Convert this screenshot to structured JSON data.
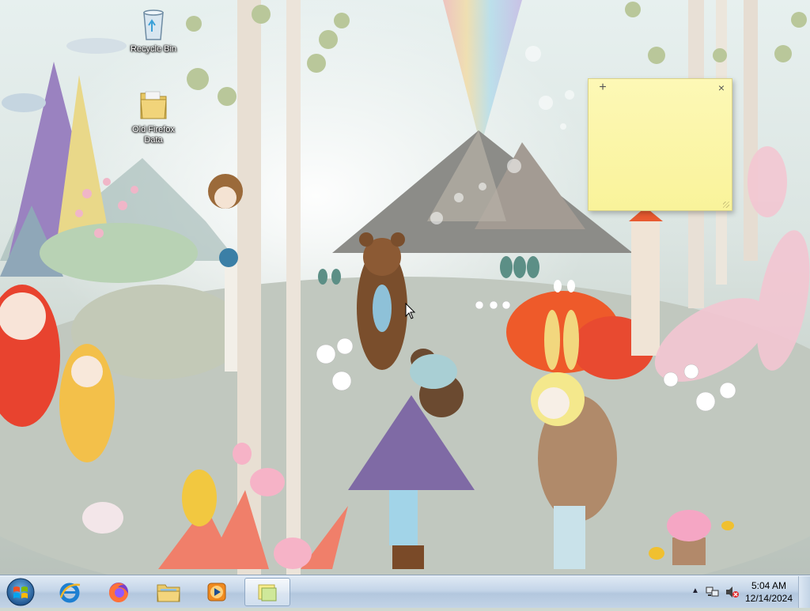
{
  "desktop": {
    "icons": [
      {
        "label": "Recycle Bin",
        "icon": "recycle-bin-icon"
      },
      {
        "label": "Old Firefox\nData",
        "icon": "folder-icon"
      }
    ]
  },
  "sticky_note": {
    "add_symbol": "+",
    "close_symbol": "×",
    "text": ""
  },
  "taskbar": {
    "start_icon": "windows-logo-icon",
    "pinned": [
      {
        "name": "Internet Explorer",
        "icon": "internet-explorer-icon"
      },
      {
        "name": "Firefox",
        "icon": "firefox-icon"
      },
      {
        "name": "Windows Explorer",
        "icon": "file-explorer-icon"
      },
      {
        "name": "Windows Media Player",
        "icon": "media-player-icon"
      },
      {
        "name": "Sticky Notes",
        "icon": "sticky-notes-icon",
        "active": true
      }
    ],
    "tray": {
      "show_hidden": "▲",
      "clock_time": "5:04 AM",
      "clock_date": "12/14/2024"
    }
  },
  "colors": {
    "taskbar_top": "#dfe9f4",
    "taskbar_bottom": "#b3c7de",
    "sticky_yellow": "#fdf8b6"
  }
}
